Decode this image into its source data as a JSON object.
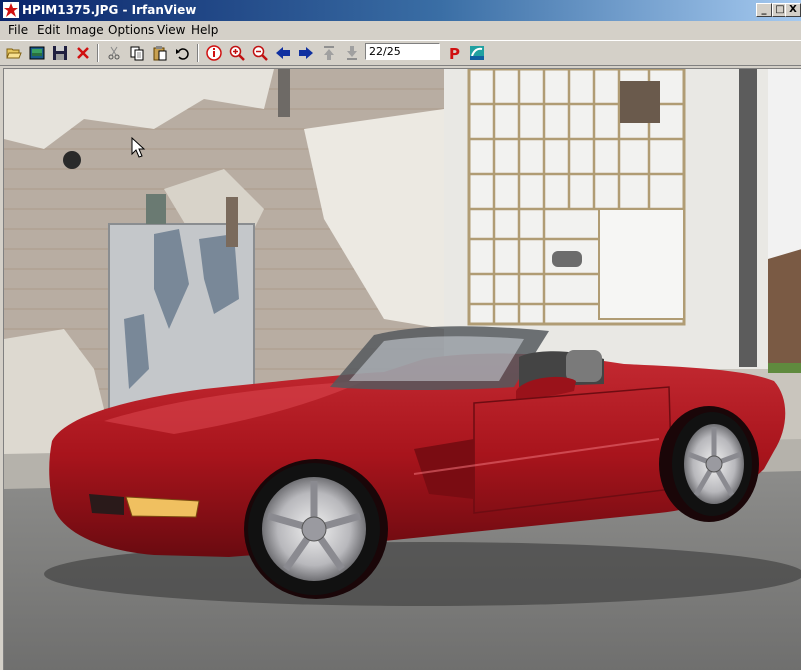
{
  "window": {
    "title": "HPIM1375.JPG - IrfanView",
    "min_symbol": "_",
    "max_symbol": "□",
    "close_symbol": "X"
  },
  "menu": [
    "File",
    "Edit",
    "Image",
    "Options",
    "View",
    "Help"
  ],
  "toolbar": {
    "page_indicator": "22/25",
    "icons": [
      "open-folder-icon",
      "slideshow-icon",
      "save-icon",
      "delete-icon",
      "cut-icon",
      "copy-icon",
      "paste-icon",
      "undo-icon",
      "info-icon",
      "zoom-in-icon",
      "zoom-out-icon",
      "previous-icon",
      "next-icon",
      "first-icon",
      "last-icon",
      "print-icon",
      "paint-icon"
    ]
  },
  "colors": {
    "title_gradient_start": "#0a246a",
    "title_gradient_end": "#a6caf0",
    "chrome": "#d4d0c8",
    "car_red": "#a8141c"
  }
}
